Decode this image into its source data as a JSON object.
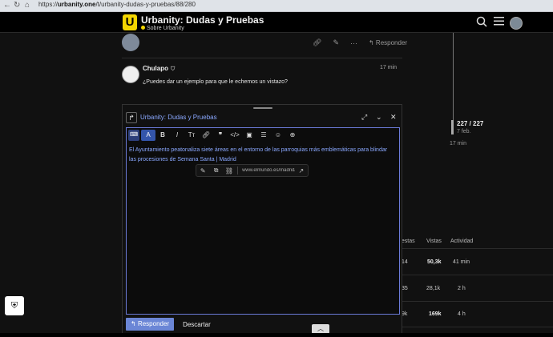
{
  "browser": {
    "url_prefix": "https://",
    "url_domain": "urbanity.one",
    "url_path": "/t/urbanity-dudas-y-pruebas/88/280"
  },
  "header": {
    "logo": "U",
    "title": "Urbanity: Dudas y Pruebas",
    "subtitle": "Sobre Urbanity"
  },
  "post_top": {
    "reply_label": "Responder"
  },
  "post": {
    "author": "Chulapo",
    "time": "17 min",
    "body": "¿Puedes dar un ejemplo para que le echemos un vistazo?"
  },
  "timeline": {
    "count": "227 / 227",
    "date": "7 feb.",
    "ago": "17 min"
  },
  "topic_table": {
    "headers": [
      "uestas",
      "Vistas",
      "Actividad"
    ],
    "rows": [
      [
        "14",
        "50,3k",
        "41 min"
      ],
      [
        "35",
        "28,1k",
        "2 h"
      ],
      [
        "9k",
        "169k",
        "4 h"
      ]
    ]
  },
  "composer": {
    "topic_title": "Urbanity: Dudas y Pruebas",
    "text": "El Ayuntamiento peatonaliza siete áreas en el entorno de las parroquias más emblemáticas para blindar las procesiones de Semana Santa | Madrid",
    "link_url": "www.elmundo.es/madrid/20…",
    "reply_button": "Responder",
    "discard_button": "Descartar"
  },
  "colors": {
    "accent": "#6b86d6",
    "link": "#8aa8ff",
    "logo": "#f4d600"
  }
}
